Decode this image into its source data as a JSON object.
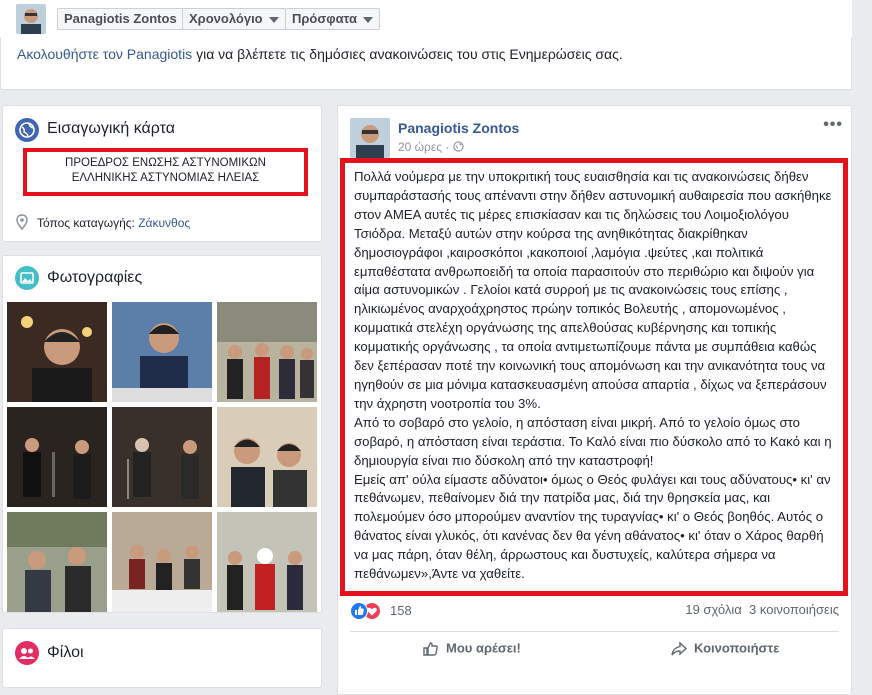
{
  "header": {
    "profile_name": "Panagiotis Zontos",
    "tabs": [
      {
        "label": "Χρονολόγιο"
      },
      {
        "label": "Πρόσφατα"
      }
    ]
  },
  "follow_notice": {
    "link_text": "Ακολουθήστε τον Panagiotis",
    "rest_text": " για να βλέπετε τις δημόσιες ανακοινώσεις του στις Ενημερώσεις σας."
  },
  "intro": {
    "title": "Εισαγωγική κάρτα",
    "bio_line1": "ΠΡΟΕΔΡΟΣ ΕΝΩΣΗΣ ΑΣΤΥΝΟΜΙΚΩΝ",
    "bio_line2": "ΕΛΛΗΝΙΚΗΣ ΑΣΤΥΝΟΜΙΑΣ ΗΛΕΙΑΣ",
    "origin_label": "Τόπος καταγωγής: ",
    "origin_value": "Ζάκυνθος"
  },
  "photos": {
    "title": "Φωτογραφίες"
  },
  "friends": {
    "title": "Φίλοι"
  },
  "post": {
    "author": "Panagiotis Zontos",
    "time": "20 ώρες ·",
    "body_p1": "Πολλά νούμερα με την υποκριτική τους ευαισθησία και τις ανακοινώσεις δήθεν συμπαράστασής τους απέναντι στην δήθεν αστυνομική αυθαιρεσία που ασκήθηκε στον ΑΜΕΑ αυτές τις μέρες επισκίασαν και τις δηλώσεις του Λοιμοξιολόγου Τσιόδρα. Μεταξύ αυτών στην κούρσα της ανηθικότητας διακρίθηκαν δημοσιογράφοι ,καιροσκόποι ,κακοποιοί ,λαμόγια .ψεύτες ,και πολιτικά εμπαθέστατα ανθρωποειδή τα οποία παρασιτούν στο περιθώριο και διψούν για αίμα αστυνομικών . Γελοίοι κατά συρροή με τις ανακοινώσεις τους επίσης , ηλικιωμένος αναρχοάχρηστος πρώην τοπικός Βολευτής , απομονωμένος , κομματικά στελέχη οργάνωσης της απελθούσας κυβέρνησης και τοπικής κομματικής οργάνωσης , τα οποία αντιμετωπίζουμε πάντα με συμπάθεια καθώς δεν ξεπέρασαν ποτέ την κοινωνική τους απομόνωση και την ανικανότητα τους να ηγηθούν σε μια μόνιμα κατασκευασμένη απούσα απαρτία , δίχως να ξεπεράσουν την άχρηστη νοοτροπία του 3%.",
    "body_p2": "Από το σοβαρό στο γελοίο, η απόσταση είναι μικρή. Από το γελοίο όμως στο σοβαρό, η απόσταση είναι τεράστια. Το Καλό είναι πιο δύσκολο από το Κακό και η δημιουργία είναι πιο δύσκολη από την καταστροφή!",
    "body_p3": "Εμείς απ' ούλα είμαστε αδύνατοι• όμως ο Θεός φυλάγει και τους αδύνατους• κι' αν πεθάνωμεν, πεθαίνομεν διά την πατρίδα μας, διά την θρησκεία μας, και πολεμούμεν όσο μπορούμεν αναντίον της τυραγνίας• κι' ο Θεός βοηθός. Αυτός ο θάνατος είναι γλυκός, ότι κανένας δεν θα γένη αθάνατος• κι' όταν ο Χάρος θαρθή να μας πάρη, όταν θέλη, άρρωστους και δυστυχείς, καλύτερα σήμερα να πεθάνωμεν»,Άντε να χαθείτε.",
    "reaction_count": "158",
    "comments": "19 σχόλια",
    "shares": "3 κοινοποιήσεις",
    "like_label": "Μου αρέσει!",
    "share_label": "Κοινοποιήστε"
  },
  "colors": {
    "link": "#365899",
    "highlight": "#e4121a",
    "like": "#2078f4",
    "love": "#f33e58"
  }
}
